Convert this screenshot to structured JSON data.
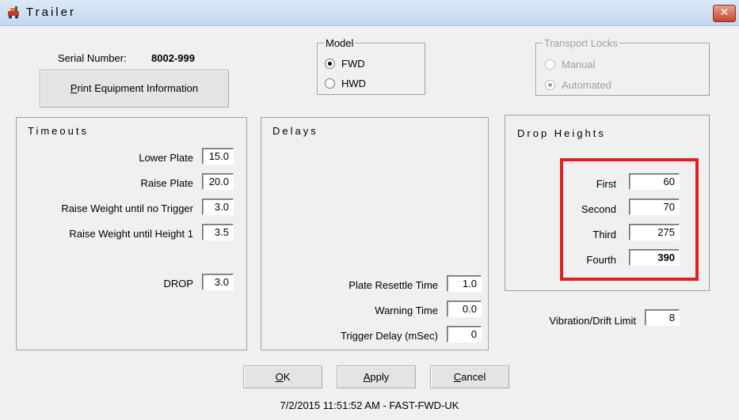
{
  "window": {
    "title": "Trailer",
    "close_glyph": "✕"
  },
  "serial": {
    "label": "Serial Number:",
    "value": "8002-999"
  },
  "print_button": {
    "label_pre": "",
    "label_underline": "P",
    "label_post": "rint Equipment Information"
  },
  "model": {
    "legend": "Model",
    "options": [
      {
        "label": "FWD",
        "selected": true
      },
      {
        "label": "HWD",
        "selected": false
      }
    ]
  },
  "transport_locks": {
    "legend": "Transport Locks",
    "enabled": false,
    "options": [
      {
        "label": "Manual",
        "selected": false
      },
      {
        "label": "Automated",
        "selected": true
      }
    ]
  },
  "timeouts": {
    "title": "Timeouts",
    "rows": [
      {
        "label": "Lower Plate",
        "value": "15.0"
      },
      {
        "label": "Raise Plate",
        "value": "20.0"
      },
      {
        "label": "Raise Weight until no Trigger",
        "value": "3.0"
      },
      {
        "label": "Raise Weight until Height 1",
        "value": "3.5"
      }
    ],
    "drop": {
      "label": "DROP",
      "value": "3.0"
    }
  },
  "delays": {
    "title": "Delays",
    "rows": [
      {
        "label": "Plate Resettle Time",
        "value": "1.0"
      },
      {
        "label": "Warning Time",
        "value": "0.0"
      },
      {
        "label": "Trigger Delay (mSec)",
        "value": "0"
      }
    ]
  },
  "drop_heights": {
    "title": "Drop Heights",
    "rows": [
      {
        "label": "First",
        "value": "60"
      },
      {
        "label": "Second",
        "value": "70"
      },
      {
        "label": "Third",
        "value": "275"
      },
      {
        "label": "Fourth",
        "value": "390"
      }
    ],
    "highlight_color": "#e02020"
  },
  "vibration": {
    "label": "Vibration/Drift Limit",
    "value": "8"
  },
  "buttons": {
    "ok": {
      "u": "O",
      "rest": "K"
    },
    "apply": {
      "u": "A",
      "rest": "pply"
    },
    "cancel": {
      "u": "C",
      "rest": "ancel"
    }
  },
  "status": {
    "text": "7/2/2015 11:51:52 AM - FAST-FWD-UK"
  }
}
